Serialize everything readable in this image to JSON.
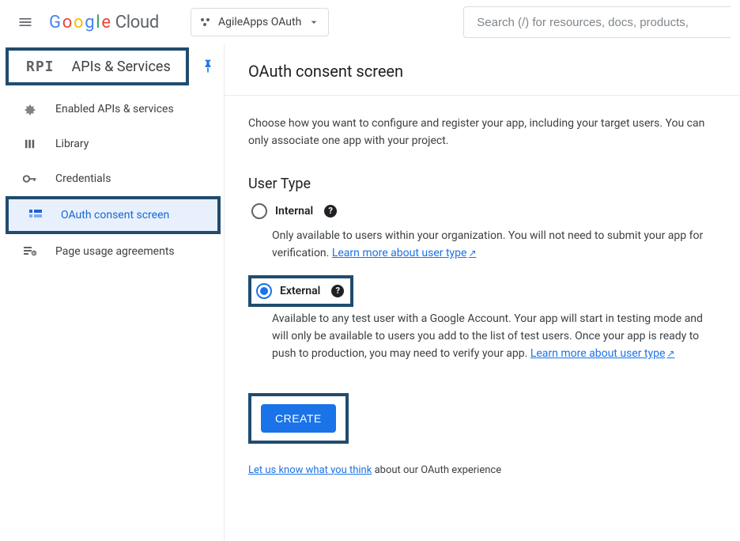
{
  "header": {
    "logo_brand": "Google",
    "logo_product": "Cloud",
    "project_label": "AgileApps OAuth",
    "search_placeholder": "Search (/) for resources, docs, products,"
  },
  "sidebar": {
    "title": "APIs & Services",
    "items": [
      {
        "label": "Enabled APIs & services"
      },
      {
        "label": "Library"
      },
      {
        "label": "Credentials"
      },
      {
        "label": "OAuth consent screen"
      },
      {
        "label": "Page usage agreements"
      }
    ]
  },
  "main": {
    "title": "OAuth consent screen",
    "intro": "Choose how you want to configure and register your app, including your target users. You can only associate one app with your project.",
    "user_type_heading": "User Type",
    "internal": {
      "label": "Internal",
      "desc_pre": "Only available to users within your organization. You will not need to submit your app for verification. ",
      "link": "Learn more about user type"
    },
    "external": {
      "label": "External",
      "desc_pre": "Available to any test user with a Google Account. Your app will start in testing mode and will only be available to users you add to the list of test users. Once your app is ready to push to production, you may need to verify your app. ",
      "link": "Learn more about user type"
    },
    "create_label": "CREATE",
    "feedback_link": "Let us know what you think",
    "feedback_suffix": " about our OAuth experience"
  }
}
